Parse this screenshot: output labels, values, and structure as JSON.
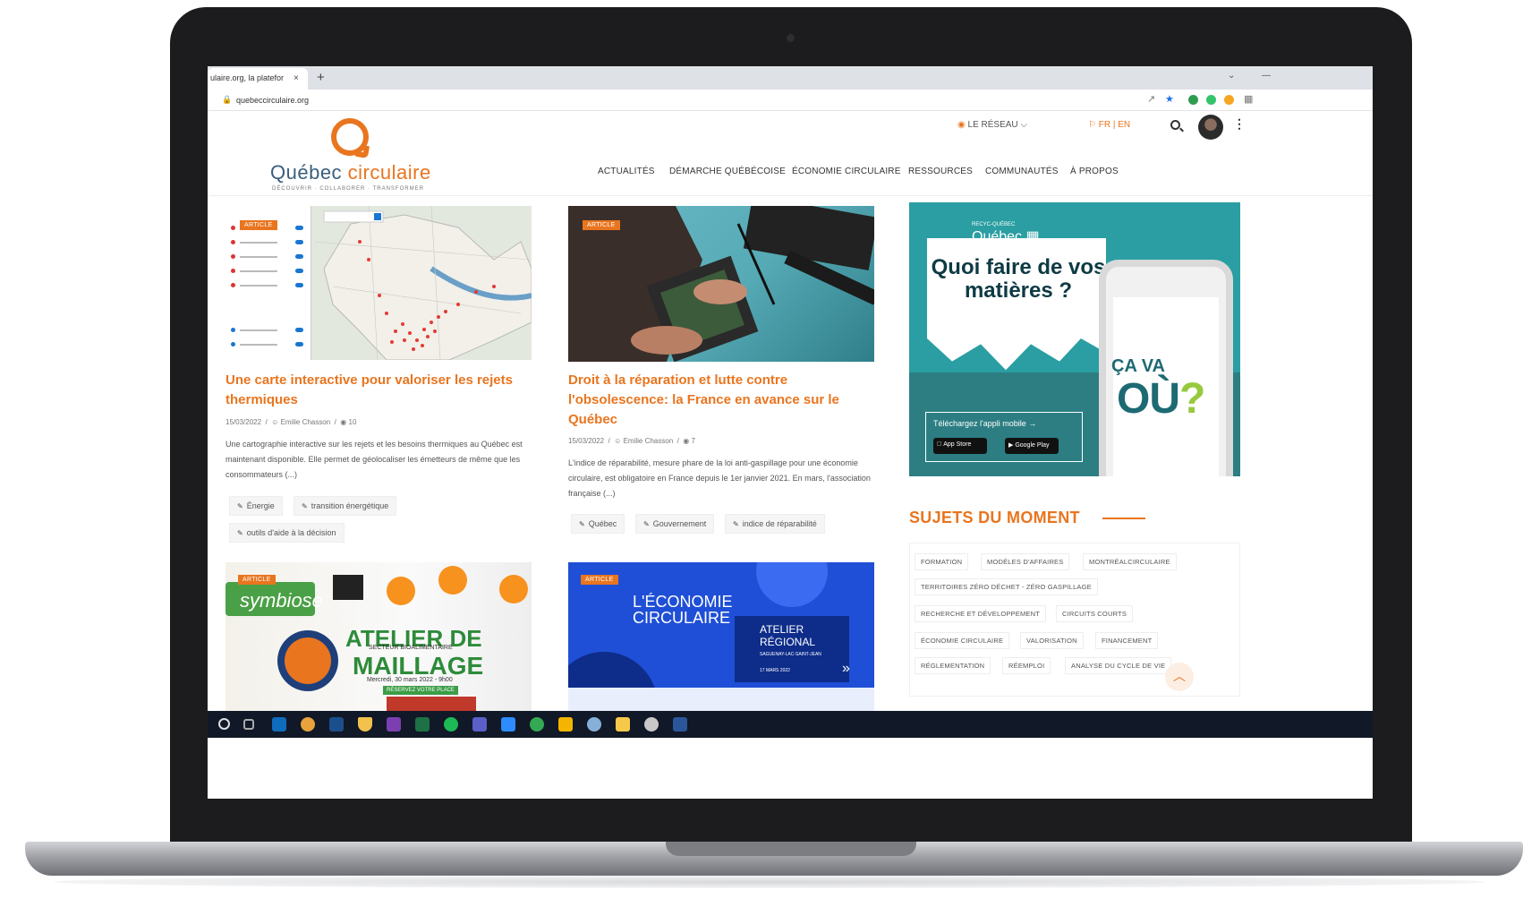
{
  "browser": {
    "tab_title": "ulaire.org, la platefor",
    "tab_close": "×",
    "new_tab": "+",
    "url": "quebeccirculaire.org",
    "win_min": "⌄",
    "win_dash": "—"
  },
  "site": {
    "brand_main": "Québec ",
    "brand_accent": "circulaire",
    "tagline": "DÉCOUVRIR · COLLABORER · TRANSFORMER",
    "reseau": "LE RÉSEAU ⌵",
    "lang": "FR | EN",
    "nav": [
      "ACTUALITÉS",
      "DÉMARCHE QUÉBÉCOISE",
      "ÉCONOMIE CIRCULAIRE",
      "RESSOURCES",
      "COMMUNAUTÉS",
      "À PROPOS"
    ]
  },
  "cards": [
    {
      "badge": "ARTICLE",
      "title": "Une carte interactive pour valoriser les rejets thermiques",
      "date": "15/03/2022",
      "author": "Emilie Chasson",
      "views": "10",
      "excerpt": "Une cartographie interactive sur les rejets et les besoins thermiques au Québec est maintenant disponible. Elle permet de géolocaliser les émetteurs de même que les consommateurs (...)",
      "tags": [
        "Énergie",
        "transition énergétique",
        "outils d'aide à la décision"
      ]
    },
    {
      "badge": "ARTICLE",
      "title": "Droit à la réparation et lutte contre l'obsolescence: la France en avance sur le Québec",
      "date": "15/03/2022",
      "author": "Emilie Chasson",
      "views": "7",
      "excerpt": "L'indice de réparabilité, mesure phare de la loi anti-gaspillage pour une économie circulaire, est obligatoire en France depuis le 1er janvier 2021. En mars, l'association française (...)",
      "tags": [
        "Québec",
        "Gouvernement",
        "indice de réparabilité"
      ]
    },
    {
      "badge": "ARTICLE",
      "img_word": "symbiose",
      "img_title_1": "ATELIER DE",
      "img_title_2": "MAILLAGE",
      "img_sub": "SECTEUR BIOALIMENTAIRE",
      "img_date": "Mercredi, 30 mars 2022 - 9h00",
      "img_cta": "RÉSERVEZ VOTRE PLACE"
    },
    {
      "badge": "ARTICLE",
      "img_line1": "L'ÉCONOMIE",
      "img_line2": "CIRCULAIRE",
      "img_box1": "ATELIER",
      "img_box2": "RÉGIONAL",
      "img_box3": "SAGUENAY-LAC-SAINT-JEAN",
      "img_box4": "17 MARS 2022"
    }
  ],
  "ad": {
    "logo_small": "RECYC-QUÉBEC",
    "logo": "Québec ▦",
    "title": "Quoi faire de vos matières ?",
    "cava": "ÇA VA",
    "ou": "OÙ",
    "q": "?",
    "download": "Téléchargez l'appli mobile →",
    "appstore": "App Store",
    "googleplay": "Google Play"
  },
  "sidebar": {
    "heading": "SUJETS DU MOMENT",
    "topics": [
      "FORMATION",
      "MODÈLES D'AFFAIRES",
      "MONTRÉALCIRCULAIRE",
      "TERRITOIRES ZÉRO DÉCHET - ZÉRO GASPILLAGE",
      "RECHERCHE ET DÉVELOPPEMENT",
      "CIRCUITS COURTS",
      "ÉCONOMIE CIRCULAIRE",
      "VALORISATION",
      "FINANCEMENT",
      "RÉGLEMENTATION",
      "RÉEMPLOI",
      "ANALYSE DU CYCLE DE VIE"
    ],
    "back_to_top": "︿"
  },
  "colors": {
    "accent": "#e9751f",
    "brand_blue": "#3a5f7d",
    "ad_teal": "#2a9ea2",
    "taskbar": "#111827"
  }
}
